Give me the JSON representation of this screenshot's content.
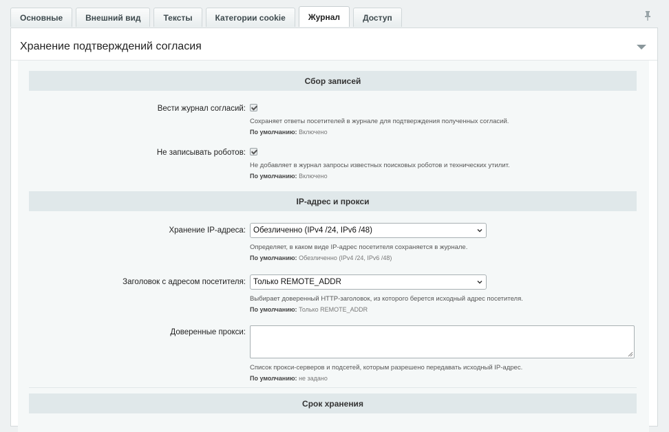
{
  "tabs": [
    {
      "label": "Основные",
      "active": false
    },
    {
      "label": "Внешний вид",
      "active": false
    },
    {
      "label": "Тексты",
      "active": false
    },
    {
      "label": "Категории cookie",
      "active": false
    },
    {
      "label": "Журнал",
      "active": true
    },
    {
      "label": "Доступ",
      "active": false
    }
  ],
  "panel": {
    "title": "Хранение подтверждений согласия"
  },
  "sections": {
    "collection": {
      "title": "Сбор записей"
    },
    "ip": {
      "title": "IP-адрес и прокси"
    },
    "retention": {
      "title": "Срок хранения"
    }
  },
  "fields": {
    "log_consents": {
      "label": "Вести журнал согласий:",
      "checked": true,
      "description": "Сохраняет ответы посетителей в журнале для подтверждения полученных согласий.",
      "default_label": "По умолчанию:",
      "default_value": "Включено"
    },
    "skip_robots": {
      "label": "Не записывать роботов:",
      "checked": true,
      "description": "Не добавляет в журнал запросы известных поисковых роботов и технических утилит.",
      "default_label": "По умолчанию:",
      "default_value": "Включено"
    },
    "ip_storage": {
      "label": "Хранение IP-адреса:",
      "value": "Обезличенно (IPv4 /24, IPv6 /48)",
      "description": "Определяет, в каком виде IP-адрес посетителя сохраняется в журнале.",
      "default_label": "По умолчанию:",
      "default_value": "Обезличенно (IPv4 /24, IPv6 /48)"
    },
    "ip_header": {
      "label": "Заголовок с адресом посетителя:",
      "value": "Только REMOTE_ADDR",
      "description": "Выбирает доверенный HTTP-заголовок, из которого берется исходный адрес посетителя.",
      "default_label": "По умолчанию:",
      "default_value": "Только REMOTE_ADDR"
    },
    "trusted_proxies": {
      "label": "Доверенные прокси:",
      "value": "",
      "description": "Список прокси-серверов и подсетей, которым разрешено передавать исходный IP-адрес.",
      "default_label": "По умолчанию:",
      "default_value": "не задано"
    }
  },
  "colors": {
    "section_bg": "#e0e8ea",
    "panel_bg": "#ffffff",
    "page_bg": "#eef1f2"
  }
}
